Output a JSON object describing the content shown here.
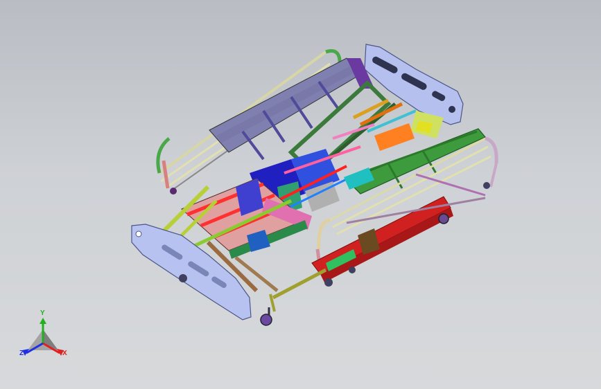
{
  "viewport": {
    "background_top": "#b9bdc3",
    "background_bottom": "#d7d9db"
  },
  "model": {
    "name": "hospital-bed-assembly",
    "headboard_color": "#b8c2f0",
    "rail_color": "#e8e6b8",
    "rail_end_color": "#5fbf4f"
  },
  "triad": {
    "x_label": "X",
    "y_label": "Y",
    "z_label": "Z",
    "x_color": "#e02020",
    "y_color": "#20b020",
    "z_color": "#2030e0"
  }
}
